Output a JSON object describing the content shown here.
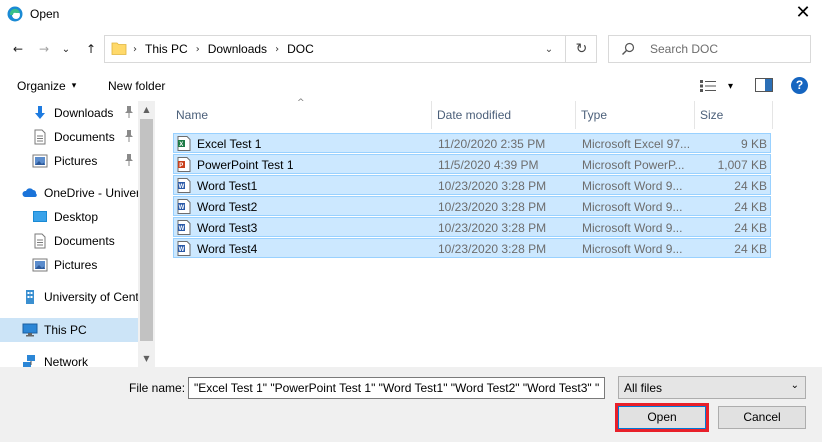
{
  "window": {
    "title": "Open",
    "close_glyph": "✕",
    "app_icon": "edge-icon"
  },
  "nav": {
    "back_glyph": "←",
    "forward_glyph": "→",
    "recent_glyph": "⌄",
    "up_glyph": "↑",
    "breadcrumbs": [
      "This PC",
      "Downloads",
      "DOC"
    ],
    "separator": "›",
    "dropdown_glyph": "⌄",
    "refresh_glyph": "↻",
    "search_placeholder": "Search DOC"
  },
  "toolbar": {
    "organize_label": "Organize",
    "organize_caret": "▾",
    "new_folder_label": "New folder",
    "view_caret": "▾",
    "help_label": "?"
  },
  "navpane": {
    "items": [
      {
        "label": "Downloads",
        "icon": "download-arrow-icon",
        "pinned": true
      },
      {
        "label": "Documents",
        "icon": "documents-icon",
        "pinned": true
      },
      {
        "label": "Pictures",
        "icon": "pictures-icon",
        "pinned": true
      },
      {
        "label": "OneDrive - Univer",
        "icon": "onedrive-cloud-icon",
        "pinned": false
      },
      {
        "label": "Desktop",
        "icon": "desktop-icon",
        "pinned": false
      },
      {
        "label": "Documents",
        "icon": "documents-icon",
        "pinned": false
      },
      {
        "label": "Pictures",
        "icon": "pictures-icon",
        "pinned": false
      },
      {
        "label": "University of Cent",
        "icon": "building-icon",
        "pinned": false
      },
      {
        "label": "This PC",
        "icon": "computer-icon",
        "pinned": false,
        "selected": true
      },
      {
        "label": "Network",
        "icon": "network-icon",
        "pinned": false
      }
    ],
    "pin_glyph": "📌",
    "scroll_up_glyph": "▲",
    "scroll_down_glyph": "▼"
  },
  "filelist": {
    "columns": {
      "name": "Name",
      "date": "Date modified",
      "type": "Type",
      "size": "Size"
    },
    "sort_glyph": "^",
    "rows": [
      {
        "name": "Excel Test 1",
        "date": "11/20/2020 2:35 PM",
        "type": "Microsoft Excel 97...",
        "size": "9 KB",
        "icon": "excel-file-icon"
      },
      {
        "name": "PowerPoint Test 1",
        "date": "11/5/2020 4:39 PM",
        "type": "Microsoft PowerP...",
        "size": "1,007 KB",
        "icon": "powerpoint-file-icon"
      },
      {
        "name": "Word Test1",
        "date": "10/23/2020 3:28 PM",
        "type": "Microsoft Word 9...",
        "size": "24 KB",
        "icon": "word-file-icon"
      },
      {
        "name": "Word Test2",
        "date": "10/23/2020 3:28 PM",
        "type": "Microsoft Word 9...",
        "size": "24 KB",
        "icon": "word-file-icon"
      },
      {
        "name": "Word Test3",
        "date": "10/23/2020 3:28 PM",
        "type": "Microsoft Word 9...",
        "size": "24 KB",
        "icon": "word-file-icon"
      },
      {
        "name": "Word Test4",
        "date": "10/23/2020 3:28 PM",
        "type": "Microsoft Word 9...",
        "size": "24 KB",
        "icon": "word-file-icon"
      }
    ]
  },
  "bottom": {
    "filename_label": "File name:",
    "filename_value": "\"Excel Test 1\" \"PowerPoint Test 1\" \"Word Test1\" \"Word Test2\" \"Word Test3\" \"",
    "filetype_value": "All files",
    "filetype_caret": "⌄",
    "open_label": "Open",
    "cancel_label": "Cancel"
  },
  "colors": {
    "selection_bg": "#cce8ff",
    "selection_border": "#99d1ff",
    "nav_selected_bg": "#cce4f7",
    "highlight_outline": "#e8202a",
    "help_blue": "#1565c0"
  }
}
